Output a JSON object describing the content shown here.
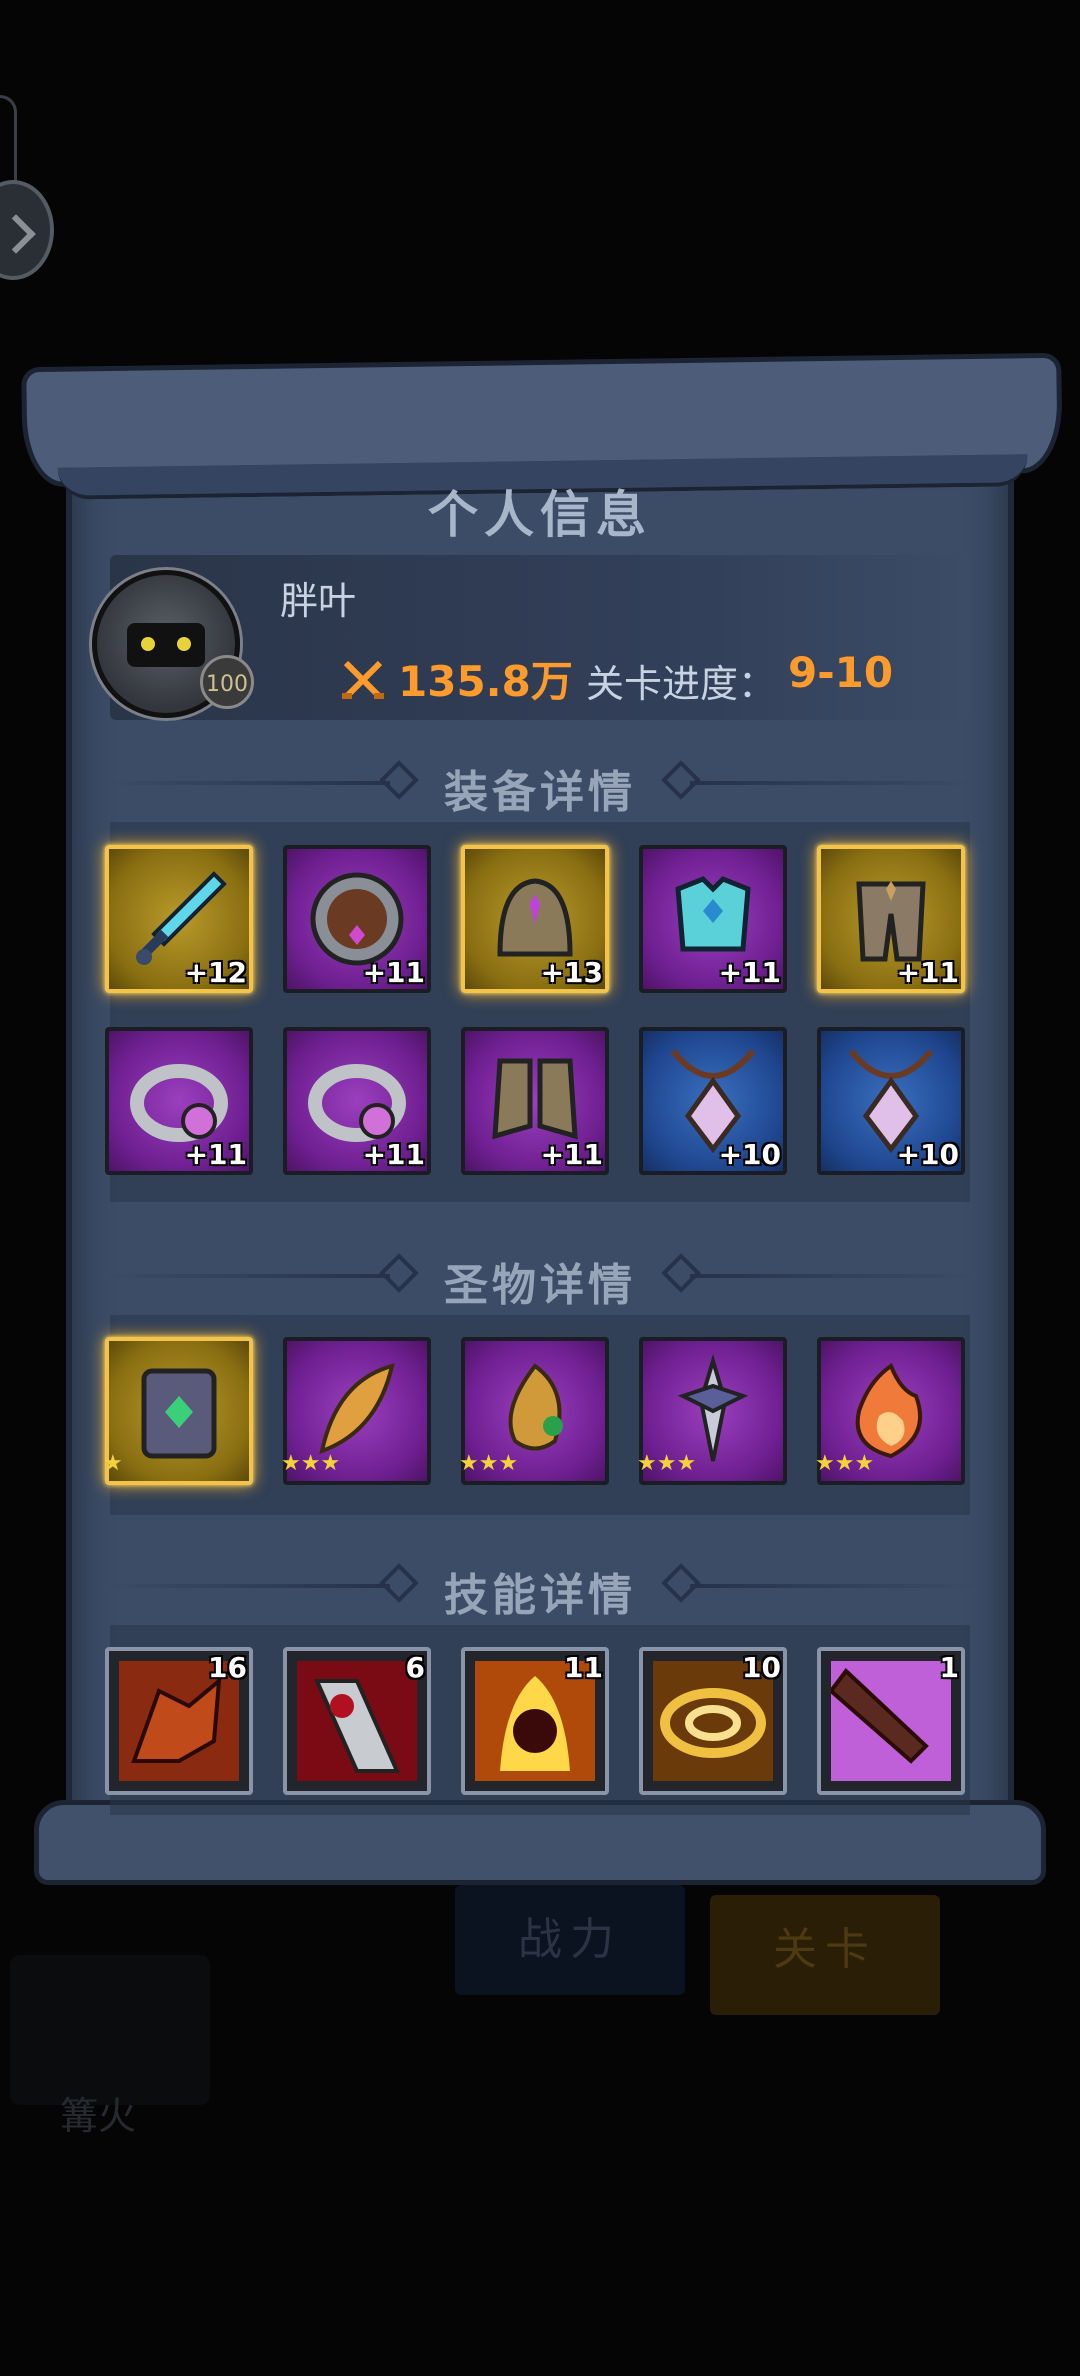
{
  "title": "个人信息",
  "player": {
    "name": "胖叶",
    "level": "100",
    "power": "135.8万",
    "stage_label": "关卡进度：",
    "stage_value": "9-10"
  },
  "sections": {
    "equipment": "装备详情",
    "relics": "圣物详情",
    "skills": "技能详情"
  },
  "equipment": [
    {
      "name": "sword-icon",
      "rarity": "gold",
      "level": "+12"
    },
    {
      "name": "shield-icon",
      "rarity": "purple",
      "level": "+11"
    },
    {
      "name": "helmet-icon",
      "rarity": "gold",
      "level": "+13"
    },
    {
      "name": "chest-armor-icon",
      "rarity": "purple",
      "level": "+11"
    },
    {
      "name": "leg-armor-icon",
      "rarity": "gold",
      "level": "+11"
    },
    {
      "name": "ring-icon",
      "rarity": "purple",
      "level": "+11"
    },
    {
      "name": "ring-icon",
      "rarity": "purple",
      "level": "+11"
    },
    {
      "name": "boots-icon",
      "rarity": "purple",
      "level": "+11"
    },
    {
      "name": "amulet-icon",
      "rarity": "blue",
      "level": "+10"
    },
    {
      "name": "amulet-icon",
      "rarity": "blue",
      "level": "+10"
    }
  ],
  "relics": [
    {
      "name": "spellbook-icon",
      "rarity": "gold",
      "stars": 1
    },
    {
      "name": "feather-icon",
      "rarity": "purple",
      "stars": 3
    },
    {
      "name": "dragon-icon",
      "rarity": "purple",
      "stars": 3
    },
    {
      "name": "dagger-icon",
      "rarity": "purple",
      "stars": 3
    },
    {
      "name": "flame-icon",
      "rarity": "purple",
      "stars": 3
    }
  ],
  "skills": [
    {
      "name": "dragon-head-skill-icon",
      "level": "16"
    },
    {
      "name": "blood-blade-skill-icon",
      "level": "6"
    },
    {
      "name": "fire-demon-skill-icon",
      "level": "11"
    },
    {
      "name": "vortex-skill-icon",
      "level": "10"
    },
    {
      "name": "piercing-strike-skill-icon",
      "level": "1"
    }
  ],
  "background": {
    "power_button": "战力",
    "stage_button": "关卡",
    "tab_label": "篝火"
  },
  "colors": {
    "accent_orange": "#ff9a2c",
    "panel": "#3c4c66",
    "purple": "#7a2aa0",
    "gold": "#f3c44a",
    "blue": "#2a57a8"
  }
}
